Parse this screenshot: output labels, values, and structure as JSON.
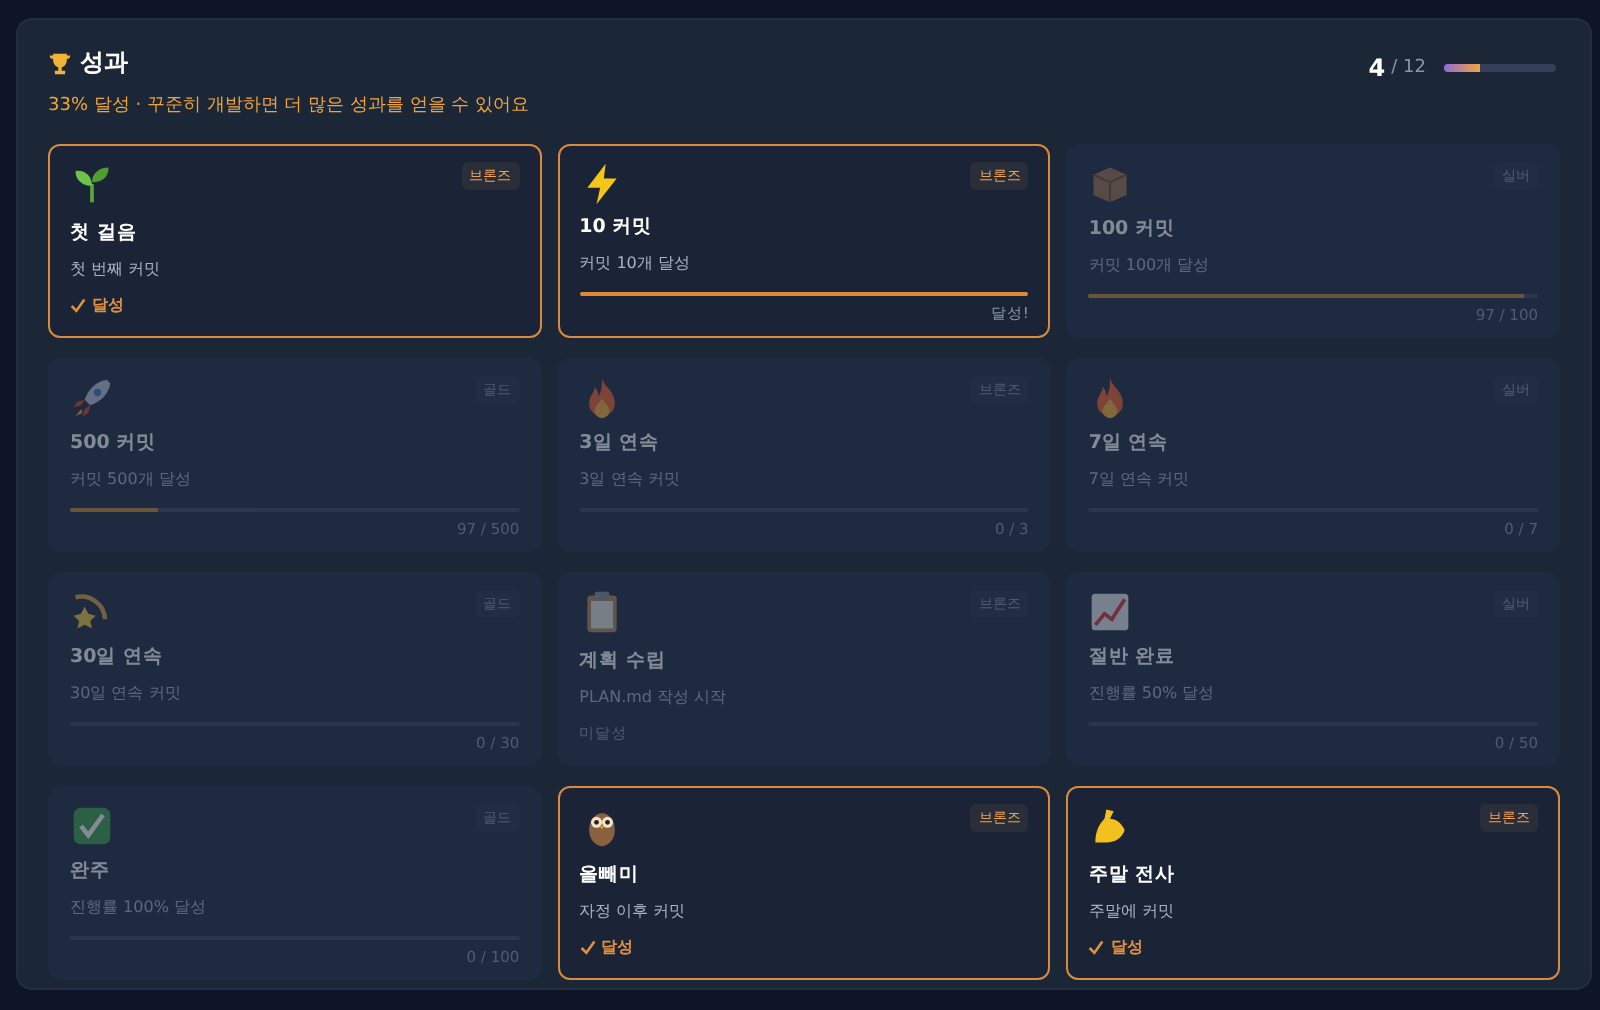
{
  "header": {
    "title": "성과",
    "subtitle": "33% 달성 · 꾸준히 개발하면 더 많은 성과를 얻을 수 있어요",
    "count": "4",
    "total": "/ 12",
    "level": 0.33
  },
  "cards": [
    {
      "title": "첫 걸음",
      "description": "첫 번째 커밋",
      "tier": "브론즈",
      "unlocked": true,
      "kind": "done",
      "status": "달성"
    },
    {
      "title": "10 커밋",
      "description": "커밋 10개 달성",
      "tier": "브론즈",
      "unlocked": true,
      "kind": "progress",
      "level": 1,
      "reading": "달성!"
    },
    {
      "title": "100 커밋",
      "description": "커밋 100개 달성",
      "tier": "실버",
      "unlocked": false,
      "kind": "progress",
      "level": 0.97,
      "reading": "97 / 100"
    },
    {
      "title": "500 커밋",
      "description": "커밋 500개 달성",
      "tier": "골드",
      "unlocked": false,
      "kind": "progress",
      "level": 0.194,
      "reading": "97 / 500"
    },
    {
      "title": "3일 연속",
      "description": "3일 연속 커밋",
      "tier": "브론즈",
      "unlocked": false,
      "kind": "progress",
      "reading": "0 / 3"
    },
    {
      "title": "7일 연속",
      "description": "7일 연속 커밋",
      "tier": "실버",
      "unlocked": false,
      "kind": "progress",
      "reading": "0 / 7"
    },
    {
      "title": "30일 연속",
      "description": "30일 연속 커밋",
      "tier": "골드",
      "unlocked": false,
      "kind": "progress",
      "reading": "0 / 30"
    },
    {
      "title": "계획 수립",
      "description": "PLAN.md 작성 시작",
      "tier": "브론즈",
      "unlocked": false,
      "kind": "pending",
      "status": "미달성"
    },
    {
      "title": "절반 완료",
      "description": "진행률 50% 달성",
      "tier": "실버",
      "unlocked": false,
      "kind": "progress",
      "reading": "0 / 50"
    },
    {
      "title": "완주",
      "description": "진행률 100% 달성",
      "tier": "골드",
      "unlocked": false,
      "kind": "progress",
      "reading": "0 / 100"
    },
    {
      "title": "올빼미",
      "description": "자정 이후 커밋",
      "tier": "브론즈",
      "unlocked": true,
      "kind": "done",
      "status": "달성"
    },
    {
      "title": "주말 전사",
      "description": "주말에 커밋",
      "tier": "브론즈",
      "unlocked": true,
      "kind": "done",
      "status": "달성"
    }
  ]
}
